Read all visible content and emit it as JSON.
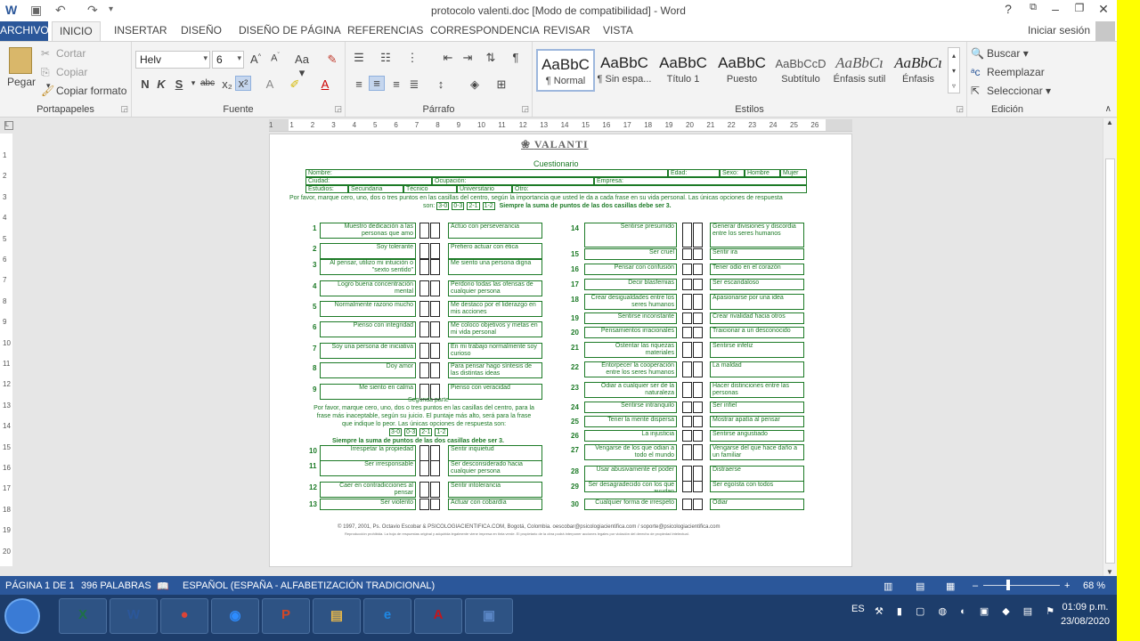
{
  "window": {
    "title": "protocolo valenti.doc [Modo de compatibilidad] - Word"
  },
  "tabs": [
    "ARCHIVO",
    "INICIO",
    "INSERTAR",
    "DISEÑO",
    "DISEÑO DE PÁGINA",
    "REFERENCIAS",
    "CORRESPONDENCIA",
    "REVISAR",
    "VISTA"
  ],
  "account": {
    "signin": "Iniciar sesión"
  },
  "ribbon": {
    "clipboard": {
      "label": "Portapapeles",
      "paste": "Pegar",
      "cut": "Cortar",
      "copy": "Copiar",
      "format_painter": "Copiar formato"
    },
    "font": {
      "label": "Fuente",
      "name": "Helv",
      "size": "6",
      "bold": "N",
      "italic": "K",
      "underline": "S",
      "strike": "abc",
      "sub": "x₂",
      "sup": "x²",
      "case": "Aa"
    },
    "paragraph": {
      "label": "Párrafo"
    },
    "styles": {
      "label": "Estilos",
      "items": [
        {
          "preview": "AaBbC",
          "name": "¶ Normal"
        },
        {
          "preview": "AaBbC",
          "name": "¶ Sin espa..."
        },
        {
          "preview": "AaBbC",
          "name": "Título 1"
        },
        {
          "preview": "AaBbC",
          "name": "Puesto"
        },
        {
          "preview": "AaBbCcD",
          "name": "Subtítulo"
        },
        {
          "preview": "AaBbCı",
          "name": "Énfasis sutil"
        },
        {
          "preview": "AaBbCı",
          "name": "Énfasis"
        }
      ]
    },
    "editing": {
      "label": "Edición",
      "find": "Buscar",
      "replace": "Reemplazar",
      "select": "Seleccionar"
    }
  },
  "document": {
    "logo": "VALANTI",
    "heading": "Cuestionario",
    "fields": {
      "name": "Nombre:",
      "age": "Edad:",
      "sex": "Sexo:",
      "male": "Hombre",
      "female": "Mujer",
      "city": "Ciudad:",
      "occupation": "Ocupación:",
      "company": "Empresa:",
      "studies": "Estudios:",
      "secondary": "Secundaria",
      "technical": "Técnico",
      "university": "Universitario",
      "other": "Otro:"
    },
    "instructions1": "Por favor, marque cero, uno, dos o tres puntos en las casillas del centro, según la importancia que usted le da a cada frase en su vida personal. Las únicas opciones de respuesta",
    "instructions1b": "son:",
    "instructions1c": "Siempre la suma de puntos de las dos casillas debe ser 3.",
    "options": [
      "3-0",
      "0-3",
      "2-1",
      "1-2"
    ],
    "part2": "Segunda parte",
    "instructions2": [
      "Por favor, marque cero, uno, dos o tres puntos en las casillas del centro, para la",
      "frase más inaceptable, según su juicio. El puntaje más alto, será para la frase",
      "que indique lo peor. Las únicas opciones de respuesta son:"
    ],
    "instructions2c": "Siempre la suma de puntos de las dos casillas debe ser 3.",
    "left_items": [
      {
        "n": "1",
        "a": "Muestro dedicación a las personas que amo",
        "b": "Actúo con perseverancia"
      },
      {
        "n": "2",
        "a": "Soy tolerante",
        "b": "Prefiero actuar con ética"
      },
      {
        "n": "3",
        "a": "Al pensar, utilizo mi intuición o \"sexto sentido\"",
        "b": "Me siento una persona digna"
      },
      {
        "n": "4",
        "a": "Logro buena concentración mental",
        "b": "Perdono todas las ofensas de cualquier persona"
      },
      {
        "n": "5",
        "a": "Normalmente razono mucho",
        "b": "Me destaco por el liderazgo en mis acciones"
      },
      {
        "n": "6",
        "a": "Pienso con integridad",
        "b": "Me coloco objetivos y metas en mi vida personal"
      },
      {
        "n": "7",
        "a": "Soy una persona de iniciativa",
        "b": "En mi trabajo normalmente soy curioso"
      },
      {
        "n": "8",
        "a": "Doy amor",
        "b": "Para pensar hago síntesis de las distintas ideas"
      },
      {
        "n": "9",
        "a": "Me siento en calma",
        "b": "Pienso con veracidad"
      }
    ],
    "left_items2": [
      {
        "n": "10",
        "a": "Irrespetar la propiedad",
        "b": "Sentir inquietud"
      },
      {
        "n": "11",
        "a": "Ser irresponsable",
        "b": "Ser desconsiderado hacia cualquier persona"
      },
      {
        "n": "12",
        "a": "Caer en contradicciones al pensar",
        "b": "Sentir intolerancia"
      },
      {
        "n": "13",
        "a": "Ser violento",
        "b": "Actuar con cobardía"
      }
    ],
    "right_items": [
      {
        "n": "14",
        "a": "Sentirse presumido",
        "b": "Generar divisiones y discordia entre los seres humanos"
      },
      {
        "n": "15",
        "a": "Ser cruel",
        "b": "Sentir ira"
      },
      {
        "n": "16",
        "a": "Pensar con confusión",
        "b": "Tener odio en el corazón"
      },
      {
        "n": "17",
        "a": "Decir blasfemias",
        "b": "Ser escandaloso"
      },
      {
        "n": "18",
        "a": "Crear desigualdades entre los seres humanos",
        "b": "Apasionarse por una idea"
      },
      {
        "n": "19",
        "a": "Sentirse inconstante",
        "b": "Crear rivalidad hacia otros"
      },
      {
        "n": "20",
        "a": "Pensamientos irracionales",
        "b": "Traicionar a un desconocido"
      },
      {
        "n": "21",
        "a": "Ostentar las riquezas materiales",
        "b": "Sentirse infeliz"
      },
      {
        "n": "22",
        "a": "Entorpecer la cooperación entre los seres humanos",
        "b": "La maldad"
      },
      {
        "n": "23",
        "a": "Odiar a cualquier ser de la naturaleza",
        "b": "Hacer distinciones entre las personas"
      },
      {
        "n": "24",
        "a": "Sentirse intranquilo",
        "b": "Ser infiel"
      },
      {
        "n": "25",
        "a": "Tener la mente dispersa",
        "b": "Mostrar apatía al pensar"
      },
      {
        "n": "26",
        "a": "La injusticia",
        "b": "Sentirse angustiado"
      },
      {
        "n": "27",
        "a": "Vengarse de los que odian a todo el mundo",
        "b": "Vengarse del que hace daño a un familiar"
      },
      {
        "n": "28",
        "a": "Usar abusivamente el poder",
        "b": "Distraerse"
      },
      {
        "n": "29",
        "a": "Ser desagradecido con los que ayudan",
        "b": "Ser egoísta con todos"
      },
      {
        "n": "30",
        "a": "Cualquier forma de irrespeto",
        "b": "Odiar"
      }
    ],
    "footer": "© 1997, 2001, Ps. Octavio Escobar & PSICOLOGIACIENTIFICA.COM, Bogotá, Colombia. oescobar@psicologiacientifica.com / soporte@psicologiacientifica.com",
    "footer2": "Reproducción prohibida. La hoja de respuestas original y adquirida legalmente viene impresa en tinta verde. El propietario de la obra podrá interponer acciones legales por violación del derecho de propiedad intelectual."
  },
  "ruler": {
    "h": [
      "1",
      "1",
      "2",
      "3",
      "4",
      "5",
      "6",
      "7",
      "8",
      "9",
      "10",
      "11",
      "12",
      "13",
      "14",
      "15",
      "16",
      "17",
      "18",
      "19",
      "20",
      "21",
      "22",
      "23",
      "24",
      "25",
      "26"
    ],
    "v": [
      "1",
      "2",
      "3",
      "4",
      "5",
      "6",
      "7",
      "8",
      "9",
      "10",
      "11",
      "12",
      "13",
      "14",
      "15",
      "16",
      "17",
      "18",
      "19",
      "20"
    ]
  },
  "status": {
    "page": "PÁGINA 1 DE 1",
    "words": "396 PALABRAS",
    "language": "ESPAÑOL (ESPAÑA - ALFABETIZACIÓN TRADICIONAL)",
    "zoom": "68 %",
    "zoom_level": 0.68
  },
  "taskbar": {
    "apps": [
      "X",
      "W",
      "●",
      "◉",
      "P",
      "▤",
      "e",
      "A",
      "▣"
    ],
    "lang": "ES",
    "time": "01:09 p.m.",
    "date": "23/08/2020"
  },
  "colors": {
    "accent": "#2b579a",
    "doc_green": "#1c7a26",
    "taskbar": "#1d3d6b"
  }
}
